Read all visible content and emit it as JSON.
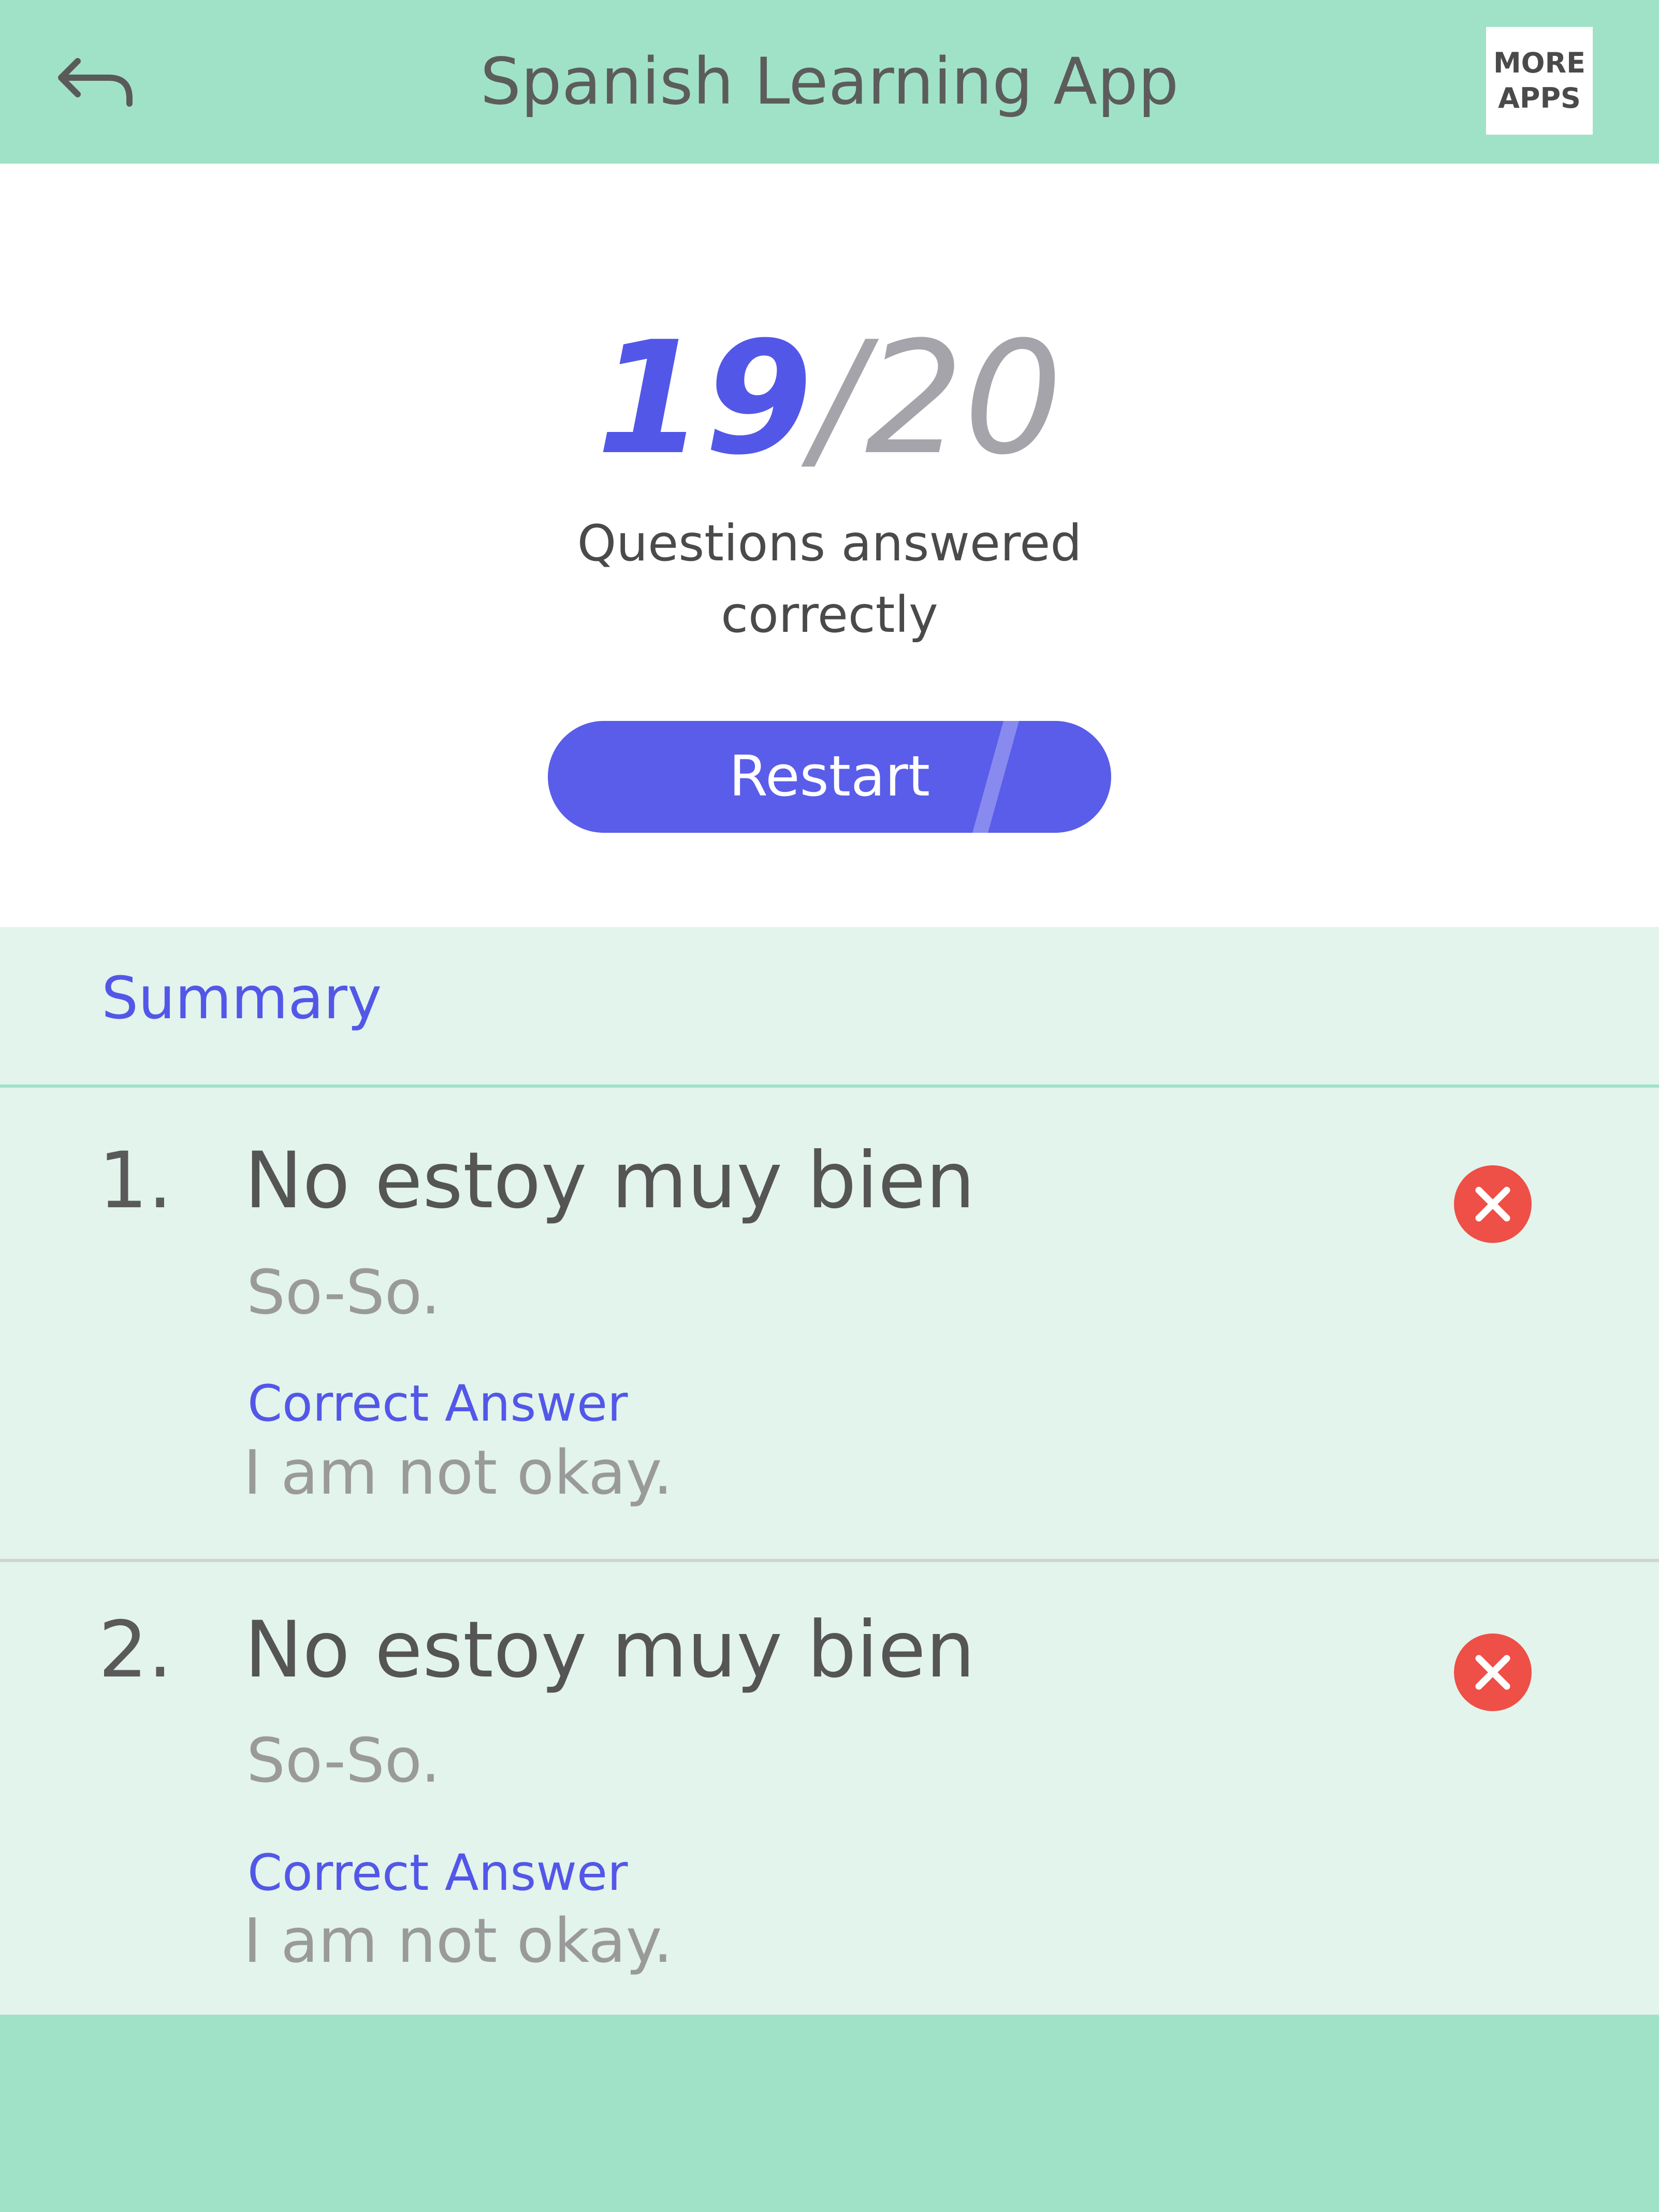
{
  "header": {
    "title": "Spanish Learning App",
    "back_icon": "back-arrow-icon",
    "more_apps_line1": "MORE",
    "more_apps_line2": "APPS"
  },
  "score": {
    "correct": "19",
    "separator": "/",
    "total": "20",
    "caption_line1": "Questions answered",
    "caption_line2": "correctly"
  },
  "restart_label": "Restart",
  "summary": {
    "title": "Summary",
    "items": [
      {
        "number": "1.",
        "question": "No estoy muy bien",
        "user_answer": "So-So.",
        "correct_label": "Correct Answer",
        "correct_answer": "I am not okay.",
        "status_icon": "wrong-answer-icon"
      },
      {
        "number": "2.",
        "question": "No estoy muy bien",
        "user_answer": "So-So.",
        "correct_label": "Correct Answer",
        "correct_answer": "I am not okay.",
        "status_icon": "wrong-answer-icon"
      }
    ]
  },
  "colors": {
    "mint": "#a0e2c8",
    "summary_bg": "#e2f4ec",
    "accent": "#5357e8",
    "wrong_red": "#ee4f47"
  }
}
